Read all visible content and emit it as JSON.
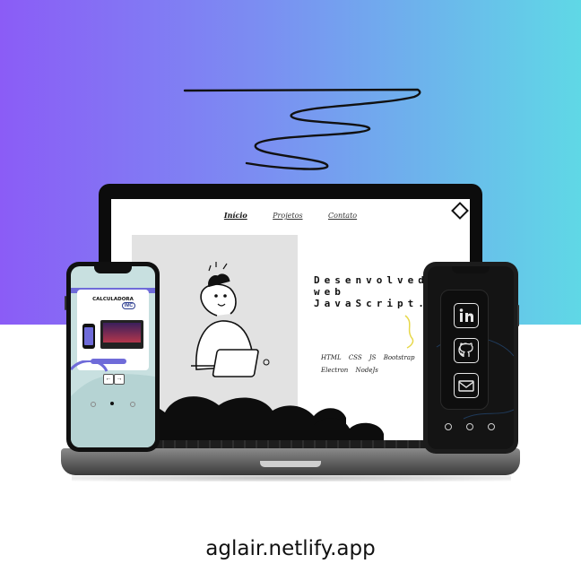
{
  "site": {
    "nav": [
      "Início",
      "Projetos",
      "Contato"
    ],
    "hero_title_lines": [
      "Desenvolved",
      "web",
      "JavaScript."
    ],
    "tech_line_1": "HTML CSS JS Bootstrap",
    "tech_line_2": "Electron NodeJs"
  },
  "mobile_left": {
    "calc_title": "CALCULADORA",
    "calc_badge": "IMC",
    "arrow_prev": "←",
    "arrow_next": "→"
  },
  "mobile_right": {
    "social_icons": [
      "linkedin-icon",
      "github-icon",
      "mail-icon"
    ]
  },
  "footer": {
    "url": "aglair.netlify.app"
  },
  "colors": {
    "gradient_start": "#8b5cf6",
    "gradient_end": "#5fd8e6",
    "accent_blue": "#2b3c8f"
  }
}
